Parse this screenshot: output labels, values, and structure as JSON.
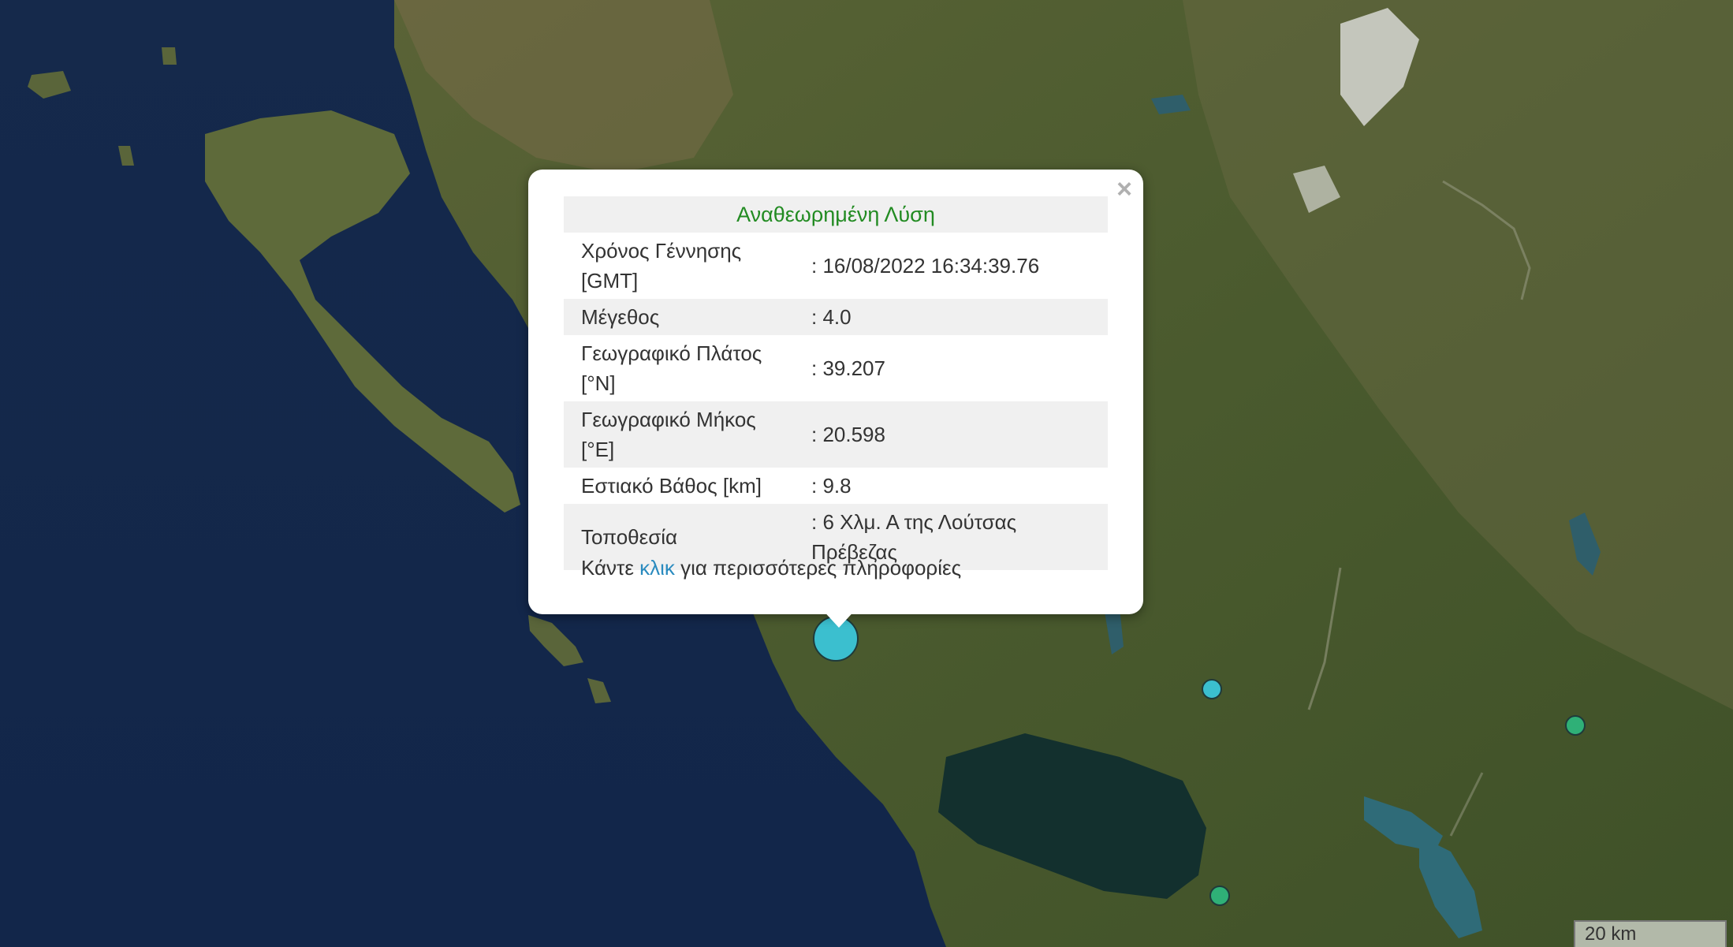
{
  "map": {
    "water_color": "#13284a",
    "land_color": "#4b5a2f",
    "lake_color": "#12302e"
  },
  "markers": [
    {
      "id": "main",
      "color": "#3bbfcf",
      "selected": true
    },
    {
      "id": "2",
      "color": "#3bbfcf"
    },
    {
      "id": "3",
      "color": "#2fb077"
    },
    {
      "id": "4",
      "color": "#2fb077"
    }
  ],
  "popup": {
    "header": "Αναθεωρημένη Λύση",
    "close_icon": "×",
    "rows": [
      {
        "label": "Χρόνος Γέννησης [GMT]",
        "value": ": 16/08/2022 16:34:39.76"
      },
      {
        "label": "Μέγεθος",
        "value": ": 4.0"
      },
      {
        "label": "Γεωγραφικό Πλάτος [°N]",
        "value": ": 39.207"
      },
      {
        "label": "Γεωγραφικό Μήκος [°E]",
        "value": ": 20.598"
      },
      {
        "label": "Εστιακό Βάθος [km]",
        "value": ": 9.8"
      },
      {
        "label": "Τοποθεσία",
        "value": ": 6 Χλμ. Α της Λούτσας Πρέβεζας"
      }
    ],
    "footer_prefix": "Κάντε ",
    "footer_link": "κλικ",
    "footer_suffix": " για περισσότερες πληροφορίες",
    "header_color": "#228b22",
    "link_color": "#2a8bbf"
  },
  "scale": {
    "label": "20 km"
  }
}
